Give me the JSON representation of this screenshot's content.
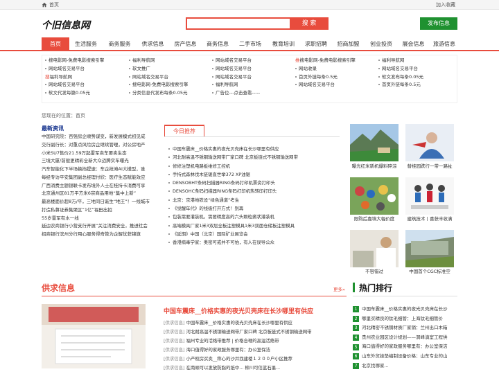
{
  "topbar": {
    "home_label": "首页",
    "favorite_label": "加入收藏"
  },
  "header": {
    "logo_text": "个旧信息网",
    "search_placeholder": "",
    "search_button": "搜 索",
    "publish_button": "发布信息"
  },
  "nav": [
    "首页",
    "生活服务",
    "商务服务",
    "供求信息",
    "房产信息",
    "商务信息",
    "二手市场",
    "教育培训",
    "求职招聘",
    "招商加盟",
    "创业投资",
    "展会信息",
    "旅游信息"
  ],
  "links": [
    [
      {
        "t": "搜电影网-免费电影搜索引擎"
      },
      {
        "t": "网站域名交易平台"
      },
      {
        "tag": "搜",
        "t": "福利导航网"
      },
      {
        "t": "网站域名交易平台"
      },
      {
        "t": "软文代发每篇0.05元"
      }
    ],
    [
      {
        "t": "福利导航网"
      },
      {
        "t": "软文推广"
      },
      {
        "t": "网站域名交易平台"
      },
      {
        "t": "搜电影网-免费电影搜索引擎"
      },
      {
        "t": "分类信息代发布每条0.05元"
      }
    ],
    [
      {
        "t": "网站域名交易平台"
      },
      {
        "t": "网站域名交易平台"
      },
      {
        "t": "网站域名交易平台"
      },
      {
        "t": "福利导航网"
      },
      {
        "t": "广告位---点击查看-----"
      }
    ],
    [
      {
        "tag": "推",
        "t": "搜电影网-免费电影搜索引擎"
      },
      {
        "t": "网站收录"
      },
      {
        "t": "首页外链每条0.5元"
      },
      {
        "t": "网站域名交易平台"
      }
    ],
    [
      {
        "t": "福利导航网"
      },
      {
        "t": "网站域名交易平台"
      },
      {
        "t": "软文发布每条0.05元"
      },
      {
        "t": "首页外链每条0.5元"
      }
    ]
  ],
  "location": {
    "label": "您现在的位置：",
    "value": "首页"
  },
  "latest": {
    "title": "最新资讯",
    "items": [
      "中国研究院：百强房企顺势谋变，新发展模式初见成",
      "交行副行长：对重点风险房企继续管理，对公房地产",
      "小米SU7售价21.59万起雷军卖车要卖生态",
      "三境大厦/前般更精彩全新大众迈腾实车曝光",
      "汽车智能化下半场换挡提速：车企抢滩AI大模型，谁",
      "每经专访平安集团副总经理付欣：医疗生态赋能效应",
      "广西消费主题银联卡发布境外人士在桂持卡消费可享",
      "北京通州区81万平方米6宗商品用地“集中上新”",
      "最高楼面价超8万/平，三地同日诞生“地王”！一线城市",
      "打造私募证券集聚区“1亿”福田出招",
      "55岁雷军有水一线",
      "延边农商银行小营支行开展“关注消费安全，推进社会",
      "招商银行滨州分行用心服务得奇赞为企解忧获锦旗"
    ]
  },
  "recommend": {
    "tab": "今日推荐",
    "items": [
      "中国车震床__价格实惠的夜光贝壳床在长沙哪里有供应",
      "河北耐高温不锈钢输送网带厂家口碑  北京板链式不锈钢输送网带",
      "修修注塑机电路板维修工控机",
      "手持式森林伐木链锯直世举372 XP油锯",
      "DENSOBHT条码扫描器RING条码打印机票资打印头",
      "DENSOHC条码扫描器RING条码打印机热转印打印头",
      "北京：京港地铁设“绿色通道”考生",
      "《觉醒年代》的线级打开方式！别再",
      "包装需要灌装机，需要精度高的六头颗粒酱状灌装机",
      "高端模具厂家1米3双层全板注塑模具1米3双面仓储板注塑模具",
      "《延期》中国（北京）国际矿业展览会",
      "香港病毒学家：奥密可戒并不可怕，有人在误导公众"
    ]
  },
  "photos": [
    {
      "caption": "曝光红米新机爆料碎淙"
    },
    {
      "caption": "替桂园跌行一带一路祉"
    },
    {
      "caption": "限购后嘉填大幅价度"
    },
    {
      "caption": "建筑技术丨喜获丰收满"
    },
    {
      "caption": "不容错过"
    },
    {
      "caption": "中国首个CGC标准空"
    }
  ],
  "supply": {
    "title": "供求信息",
    "more": "更多»",
    "head": "中国车震床__价格实惠的夜光贝壳床在长沙哪里有供应",
    "tag": "[供求信息]",
    "items": [
      "中国车震床__价格实惠的夜光贝壳床在长沙哪里有供应",
      "河北耐高温不锈钢输送网带厂家口碑  北京板链式不锈钢输送网带",
      "福州专业的活络带推荐 | 价格合理的高温活络带",
      "海口值得好的家政服务哪里有：办公室保洁",
      "小产权房买卖__称心的沙井找建楼１２００户小区推荐",
      "在南顺可以发放防脂的纸中...  柳川可信蓝石墨..."
    ]
  },
  "hot": {
    "title": "热门排行",
    "items": [
      "中国车震床__价格实惠的夜光贝壳床在长沙",
      "哪里买精良的钛毛细管：上海钛毛细管价",
      "河北精密不锈钢材质厂家销：兰州出口木箱",
      "贵州农业园区设计规划——洞峰滇室工程供",
      "海口值得好的家政服务哪里有：办公室保洁",
      "山东外贸挂垫编制设备价格：山东专业的山",
      "北京找哪家..."
    ]
  }
}
